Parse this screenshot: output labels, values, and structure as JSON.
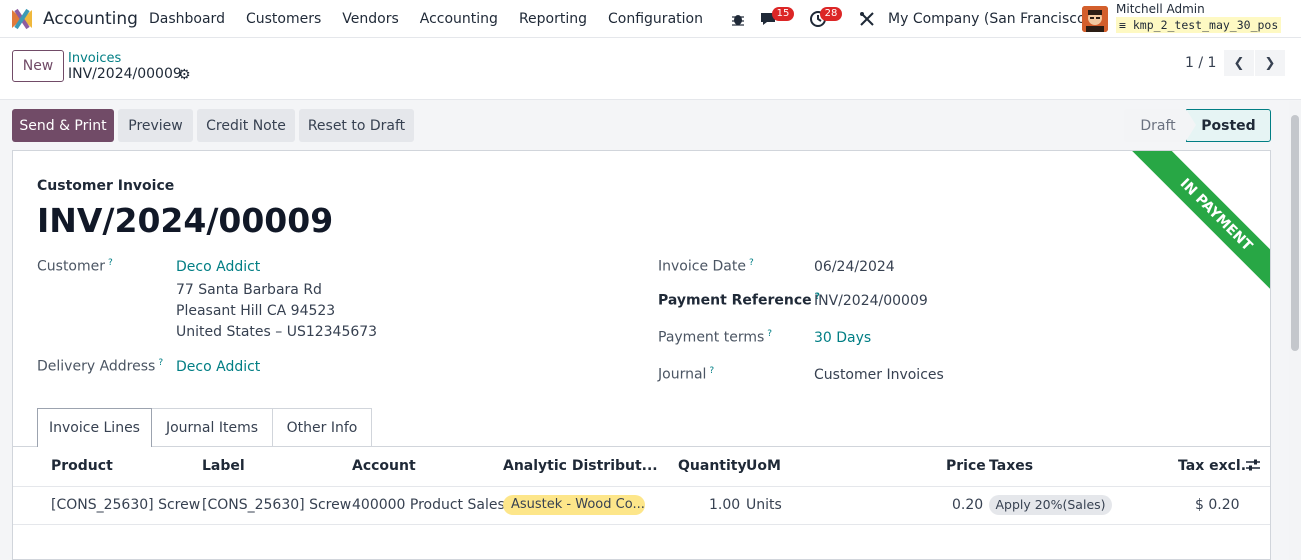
{
  "navbar": {
    "app_name": "Accounting",
    "menu": [
      "Dashboard",
      "Customers",
      "Vendors",
      "Accounting",
      "Reporting",
      "Configuration"
    ],
    "messages_badge": "15",
    "activities_badge": "28",
    "company": "My Company (San Francisco)",
    "user": "Mitchell Admin",
    "database": "kmp_2_test_may_30_pos"
  },
  "control": {
    "new_label": "New",
    "breadcrumb_parent": "Invoices",
    "breadcrumb_current": "INV/2024/00009",
    "pager": "1 / 1"
  },
  "actions": {
    "send_print": "Send & Print",
    "preview": "Preview",
    "credit_note": "Credit Note",
    "reset_draft": "Reset to Draft"
  },
  "statusbar": {
    "draft": "Draft",
    "posted": "Posted"
  },
  "invoice": {
    "ribbon": "IN PAYMENT",
    "type": "Customer Invoice",
    "number": "INV/2024/00009",
    "customer_label": "Customer",
    "customer_name": "Deco Addict",
    "address_line1": "77 Santa Barbara Rd",
    "address_line2": "Pleasant Hill CA 94523",
    "address_line3": "United States – US12345673",
    "delivery_label": "Delivery Address",
    "delivery_value": "Deco Addict",
    "invoice_date_label": "Invoice Date",
    "invoice_date": "06/24/2024",
    "payment_ref_label": "Payment Reference",
    "payment_ref": "INV/2024/00009",
    "payment_terms_label": "Payment terms",
    "payment_terms": "30 Days",
    "journal_label": "Journal",
    "journal": "Customer Invoices",
    "help_mark": "?"
  },
  "tabs": [
    "Invoice Lines",
    "Journal Items",
    "Other Info"
  ],
  "table": {
    "headers": {
      "product": "Product",
      "label": "Label",
      "account": "Account",
      "analytic": "Analytic Distribut...",
      "quantity": "Quantity",
      "uom": "UoM",
      "price": "Price",
      "taxes": "Taxes",
      "tax_excl": "Tax excl."
    },
    "rows": [
      {
        "product": "[CONS_25630] Screw",
        "label": "[CONS_25630] Screw",
        "account": "400000 Product Sales",
        "analytic": "Asustek - Wood Co...",
        "quantity": "1.00",
        "uom": "Units",
        "price": "0.20",
        "taxes": "Apply 20%(Sales)",
        "tax_excl": "$ 0.20"
      }
    ]
  },
  "colors": {
    "brand": "#714b67",
    "link": "#017e84",
    "ribbon": "#28a745",
    "badge": "#dc2626"
  }
}
